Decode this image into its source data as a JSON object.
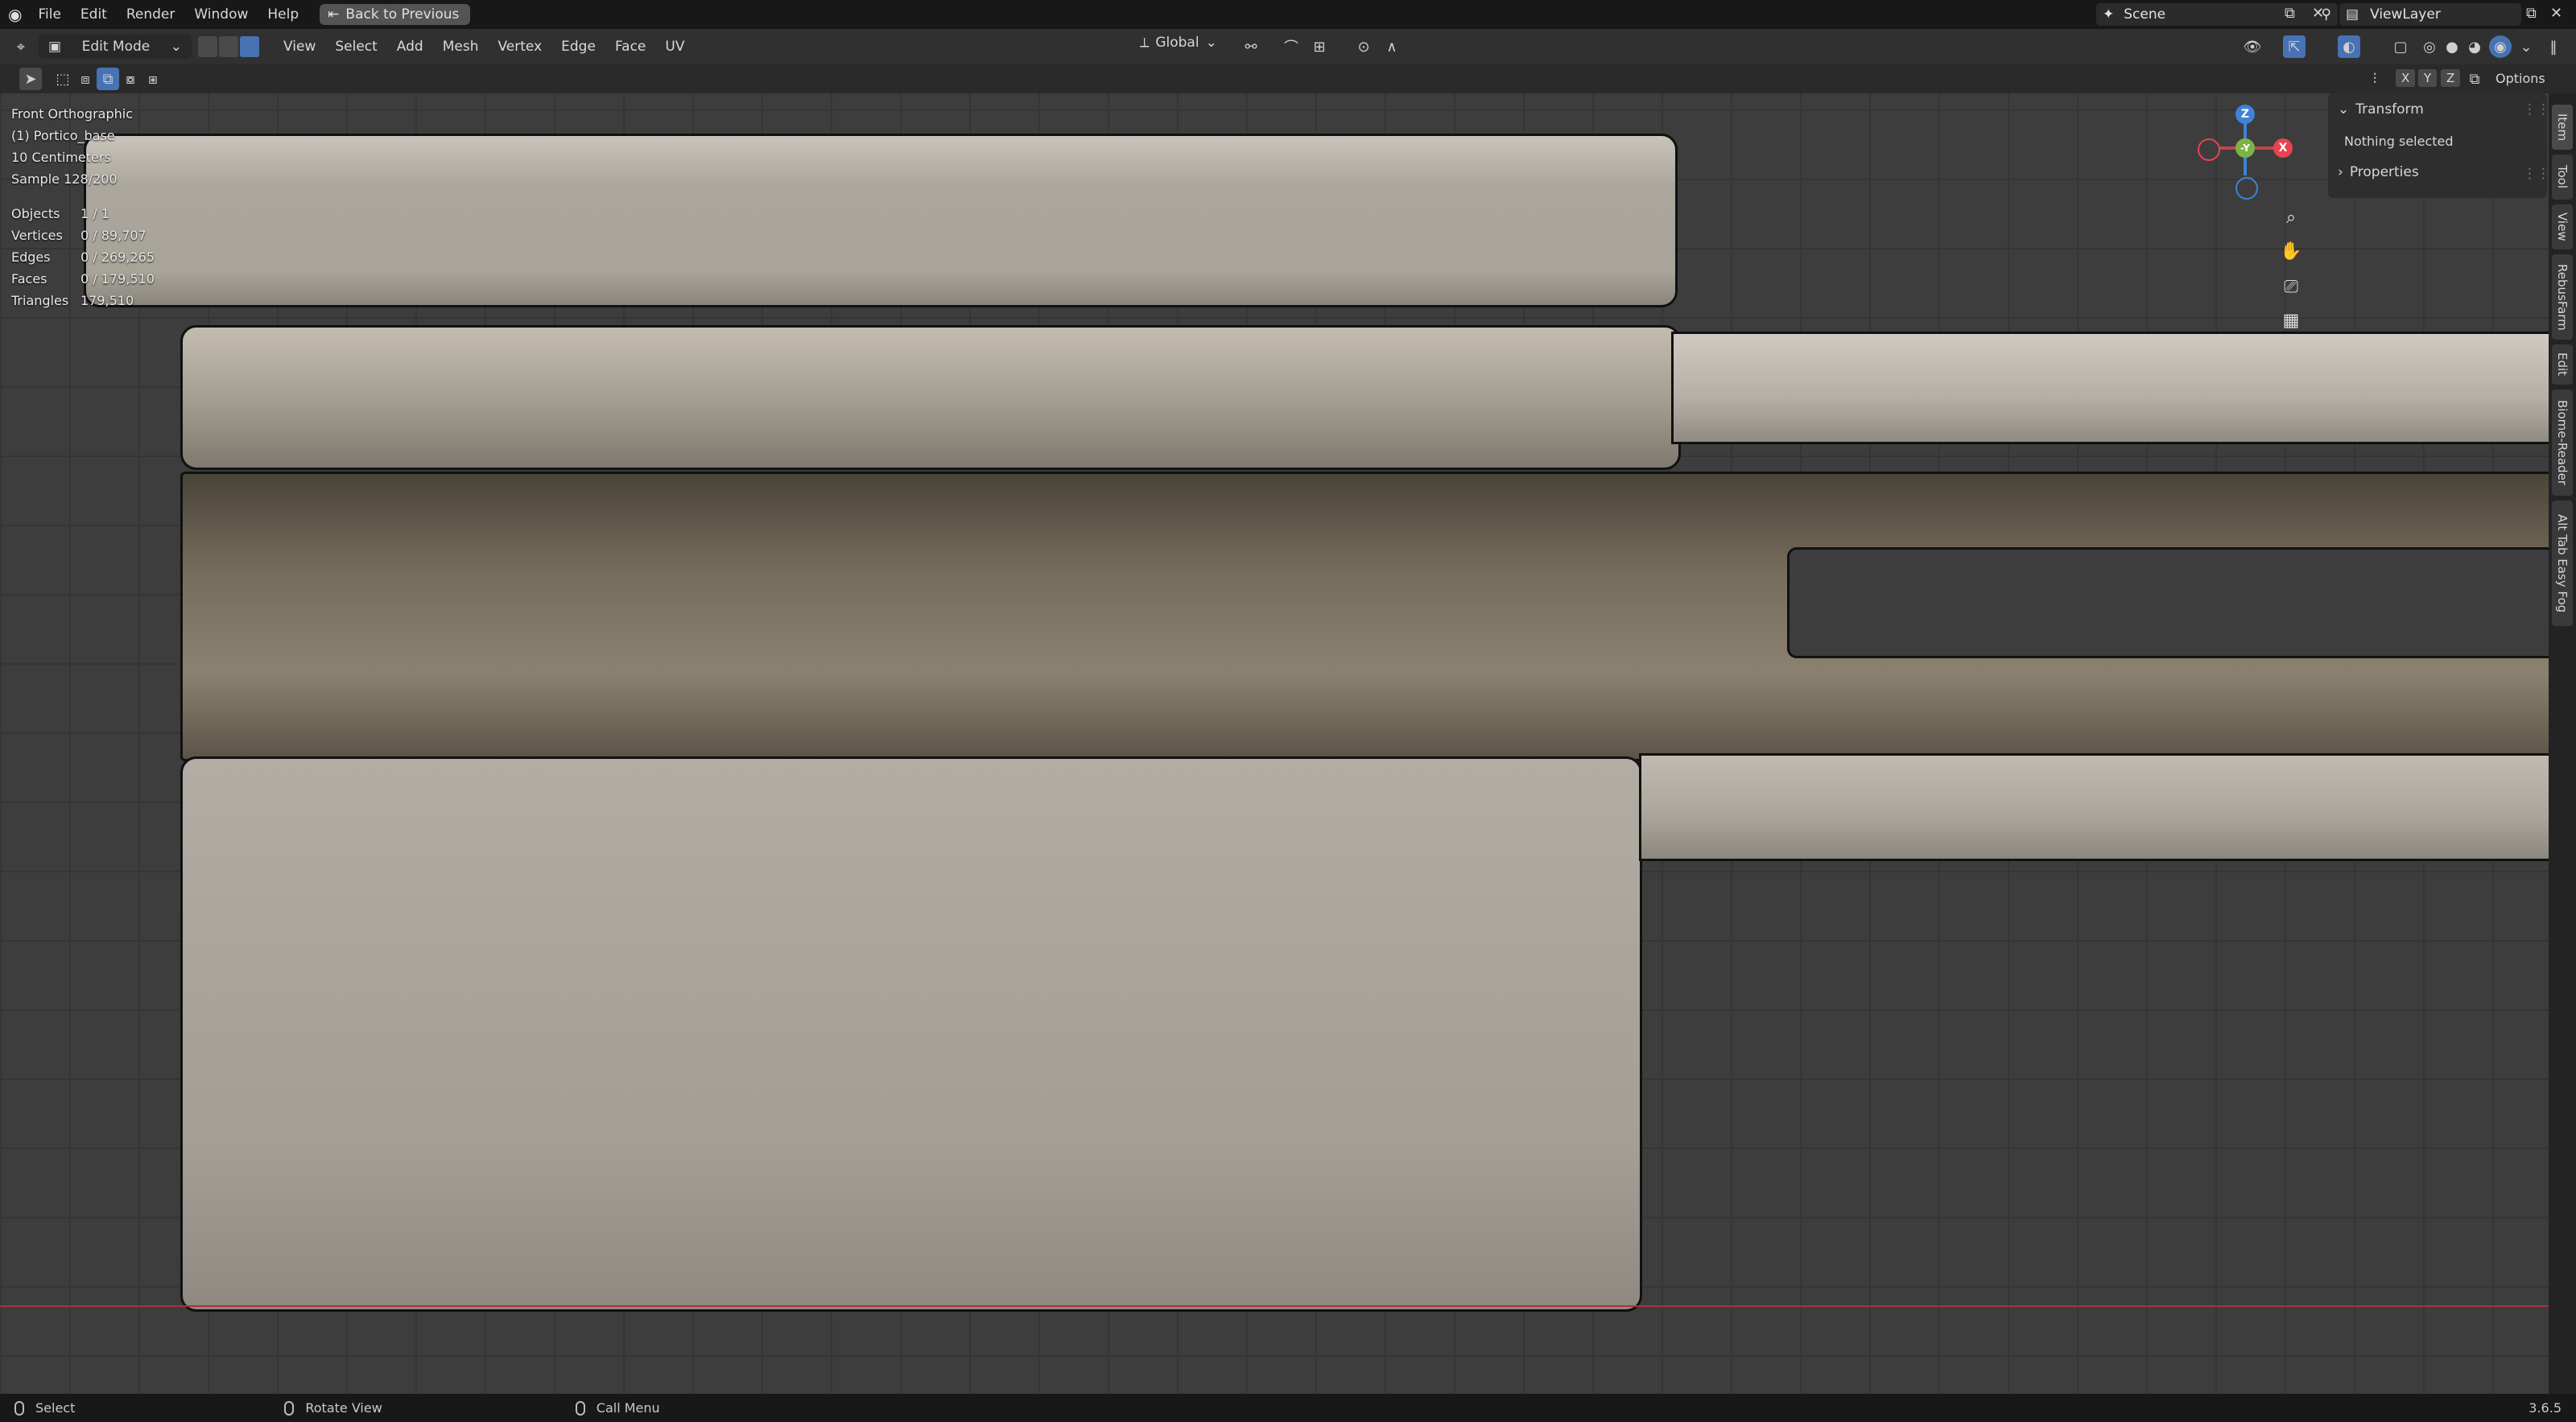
{
  "topbar": {
    "menu": [
      "File",
      "Edit",
      "Render",
      "Window",
      "Help"
    ],
    "back_button": "Back to Previous",
    "scene": "Scene",
    "view_layer": "ViewLayer"
  },
  "header": {
    "mode": "Edit Mode",
    "menu": [
      "View",
      "Select",
      "Add",
      "Mesh",
      "Vertex",
      "Edge",
      "Face",
      "UV"
    ],
    "transform_orientation": "Global",
    "axes": [
      "X",
      "Y",
      "Z"
    ],
    "options": "Options"
  },
  "viewport": {
    "view_name": "Front Orthographic",
    "object_name": "(1) Portico_base",
    "scale": "10 Centimeters",
    "sample": "Sample 128/200",
    "stats": [
      {
        "label": "Objects",
        "value": "1 / 1"
      },
      {
        "label": "Vertices",
        "value": "0 / 89,707"
      },
      {
        "label": "Edges",
        "value": "0 / 269,265"
      },
      {
        "label": "Faces",
        "value": "0 / 179,510"
      },
      {
        "label": "Triangles",
        "value": "179,510"
      }
    ],
    "gizmo": {
      "z": "Z",
      "y": "-Y",
      "x": "X"
    }
  },
  "npanel": {
    "transform_label": "Transform",
    "nothing_selected": "Nothing selected",
    "properties_label": "Properties",
    "tabs": [
      "Item",
      "Tool",
      "View",
      "RebusFarm",
      "Edit",
      "Biome-Reader",
      "Alt Tab Easy Fog"
    ]
  },
  "statusbar": {
    "select": "Select",
    "rotate": "Rotate View",
    "call_menu": "Call Menu",
    "version": "3.6.5"
  },
  "colors": {
    "accent": "#4772b3",
    "x_axis": "#e8434f",
    "y_axis": "#7cb342",
    "z_axis": "#3f82d6"
  }
}
